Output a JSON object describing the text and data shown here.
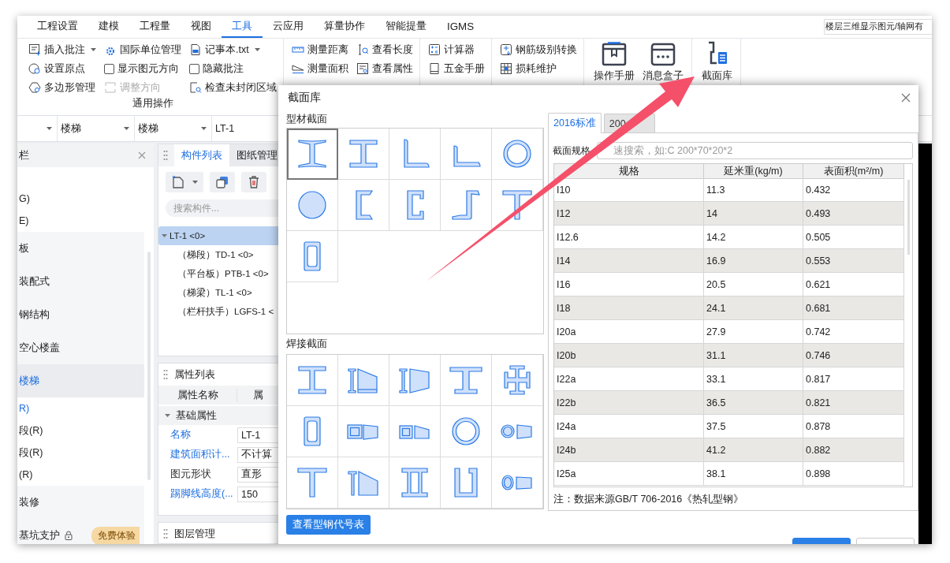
{
  "ribbon_tabs": [
    {
      "label": "工程设置",
      "selected": false
    },
    {
      "label": "建模",
      "selected": false
    },
    {
      "label": "工程量",
      "selected": false
    },
    {
      "label": "视图",
      "selected": false
    },
    {
      "label": "工具",
      "selected": true
    },
    {
      "label": "云应用",
      "selected": false
    },
    {
      "label": "算量协作",
      "selected": false
    },
    {
      "label": "智能提量",
      "selected": false
    },
    {
      "label": "IGMS",
      "selected": false
    }
  ],
  "floor_display_field": {
    "value": "楼层三维显示图元/轴网有"
  },
  "ribbon_groups": [
    {
      "title": "通用操作",
      "items": [
        {
          "kind": "button",
          "label": "插入批注",
          "dropdown": true,
          "disabled": false
        },
        {
          "kind": "button",
          "label": "国际单位管理",
          "dropdown": false,
          "disabled": false
        },
        {
          "kind": "button",
          "label": "记事本.txt",
          "dropdown": true,
          "disabled": false
        },
        {
          "kind": "button",
          "label": "设置原点",
          "dropdown": false,
          "disabled": false
        },
        {
          "kind": "checkbox",
          "label": "显示图元方向",
          "checked": false,
          "dropdown": false,
          "disabled": false
        },
        {
          "kind": "checkbox",
          "label": "隐藏批注",
          "checked": false,
          "dropdown": false,
          "disabled": false
        },
        {
          "kind": "button",
          "label": "多边形管理",
          "dropdown": false,
          "disabled": false
        },
        {
          "kind": "button",
          "label": "调整方向",
          "dropdown": false,
          "disabled": true
        },
        {
          "kind": "button",
          "label": "检查未封闭区域",
          "dropdown": false,
          "disabled": false
        }
      ]
    },
    {
      "items": [
        {
          "kind": "button",
          "label": "测量距离",
          "dropdown": false,
          "disabled": false
        },
        {
          "kind": "button",
          "label": "查看长度",
          "dropdown": false,
          "disabled": false
        },
        {
          "kind": "button",
          "label": "测量面积",
          "dropdown": false,
          "disabled": false
        },
        {
          "kind": "button",
          "label": "查看属性",
          "dropdown": false,
          "disabled": false
        }
      ]
    },
    {
      "items": [
        {
          "kind": "button",
          "label": "计算器",
          "dropdown": false,
          "disabled": false
        },
        {
          "kind": "button",
          "label": "五金手册",
          "dropdown": false,
          "disabled": false
        }
      ]
    },
    {
      "items": [
        {
          "kind": "button",
          "label": "钢筋级别转换",
          "dropdown": false,
          "disabled": false
        },
        {
          "kind": "button",
          "label": "损耗维护",
          "dropdown": false,
          "disabled": false
        }
      ]
    },
    {
      "items": [
        {
          "kind": "large",
          "label": "操作手册",
          "dropdown": false,
          "disabled": false
        },
        {
          "kind": "large",
          "label": "消息盒子",
          "dropdown": false,
          "disabled": false
        }
      ]
    },
    {
      "items": [
        {
          "kind": "large",
          "label": "截面库",
          "dropdown": false,
          "disabled": false
        }
      ]
    }
  ],
  "selectors": [
    {
      "value": "楼梯"
    },
    {
      "value": "楼梯"
    },
    {
      "value": "LT-1"
    }
  ],
  "nav_panel": {
    "title": "栏",
    "items": [
      {
        "kind": "item",
        "label": "G)",
        "selected": false,
        "locked": false
      },
      {
        "kind": "item",
        "label": "E)",
        "selected": false,
        "locked": false
      },
      {
        "kind": "category",
        "label": "板",
        "selected": false,
        "locked": false
      },
      {
        "kind": "category",
        "label": "装配式",
        "selected": false,
        "locked": false
      },
      {
        "kind": "category",
        "label": "钢结构",
        "selected": false,
        "locked": false
      },
      {
        "kind": "category",
        "label": "空心楼盖",
        "selected": false,
        "locked": false
      },
      {
        "kind": "category",
        "label": "楼梯",
        "selected": true,
        "locked": false
      },
      {
        "kind": "item",
        "label": "R)",
        "selected": true,
        "locked": false
      },
      {
        "kind": "item",
        "label": "段(R)",
        "selected": false,
        "locked": false
      },
      {
        "kind": "item",
        "label": "段(R)",
        "selected": false,
        "locked": false
      },
      {
        "kind": "item",
        "label": "(R)",
        "selected": false,
        "locked": false
      },
      {
        "kind": "category",
        "label": "装修",
        "selected": false,
        "locked": false
      },
      {
        "kind": "category",
        "label": "基坑支护",
        "selected": false,
        "locked": true,
        "badge": "免费体验"
      }
    ]
  },
  "component_panel": {
    "tabs": [
      {
        "label": "构件列表",
        "selected": true
      },
      {
        "label": "图纸管理",
        "selected": false
      }
    ],
    "search": {
      "placeholder": "搜索构件..."
    },
    "tree": [
      {
        "label": "LT-1 <0>",
        "selected": true,
        "expanded": true,
        "children": [
          {
            "label": "（梯段）TD-1 <0>",
            "selected": false
          },
          {
            "label": "（平台板）PTB-1 <0>",
            "selected": false
          },
          {
            "label": "（梯梁）TL-1 <0>",
            "selected": false
          },
          {
            "label": "（栏杆扶手）LGFS-1 <",
            "selected": false
          }
        ]
      }
    ]
  },
  "properties_panel": {
    "title": "属性列表",
    "columns": [
      "属性名称",
      "属"
    ],
    "group": {
      "label": "基础属性",
      "expanded": true
    },
    "rows": [
      {
        "name": "名称",
        "value": "LT-1",
        "color": "#1f6fe0"
      },
      {
        "name": "建筑面积计...",
        "value": "不计算",
        "color": "#1f6fe0"
      },
      {
        "name": "图元形状",
        "value": "直形",
        "color": "#333333"
      },
      {
        "name": "踢脚线高度(...",
        "value": "150",
        "color": "#1f6fe0"
      }
    ]
  },
  "layers_panel": {
    "title": "图层管理"
  },
  "dialog": {
    "title": "截面库",
    "profile_sections": {
      "title": "型材截面",
      "items": [
        {
          "kind": "i-tapered",
          "selected": true
        },
        {
          "kind": "i-beam",
          "selected": false
        },
        {
          "kind": "angle-equal",
          "selected": false
        },
        {
          "kind": "angle-unequal",
          "selected": false
        },
        {
          "kind": "pipe",
          "selected": false
        },
        {
          "kind": "round-bar",
          "selected": false
        },
        {
          "kind": "channel-tapered",
          "selected": false
        },
        {
          "kind": "channel",
          "selected": false
        },
        {
          "kind": "z-section",
          "selected": false
        },
        {
          "kind": "t-section",
          "selected": false
        },
        {
          "kind": "rect-tube",
          "selected": false
        }
      ]
    },
    "welded_sections": {
      "title": "焊接截面",
      "items": [
        {
          "kind": "i-beam",
          "selected": false
        },
        {
          "kind": "i-variable",
          "selected": false
        },
        {
          "kind": "i-variable-wide",
          "selected": false
        },
        {
          "kind": "i-wide",
          "selected": false
        },
        {
          "kind": "cross",
          "selected": false
        },
        {
          "kind": "rect-tube",
          "selected": false
        },
        {
          "kind": "box-variable",
          "selected": false
        },
        {
          "kind": "box-variable-small",
          "selected": false
        },
        {
          "kind": "pipe",
          "selected": false
        },
        {
          "kind": "pipe-variable",
          "selected": false
        },
        {
          "kind": "t-section",
          "selected": false
        },
        {
          "kind": "t-variable",
          "selected": false
        },
        {
          "kind": "double-i",
          "selected": false
        },
        {
          "kind": "u-section",
          "selected": false
        },
        {
          "kind": "ellipse-variable",
          "selected": false
        }
      ]
    },
    "code_table_button": "查看型钢代号表",
    "standard_tabs": [
      {
        "label": "2016标准",
        "selected": true
      },
      {
        "label": "200",
        "selected": false
      }
    ],
    "search": {
      "label": "截面规格",
      "placeholder": "速搜索，如:C 200*70*20*2"
    },
    "table": {
      "columns": [
        "规格",
        "延米重(kg/m)",
        "表面积(m²/m)"
      ],
      "rows": [
        [
          "I10",
          "11.3",
          "0.432"
        ],
        [
          "I12",
          "14",
          "0.493"
        ],
        [
          "I12.6",
          "14.2",
          "0.505"
        ],
        [
          "I14",
          "16.9",
          "0.553"
        ],
        [
          "I16",
          "20.5",
          "0.621"
        ],
        [
          "I18",
          "24.1",
          "0.681"
        ],
        [
          "I20a",
          "27.9",
          "0.742"
        ],
        [
          "I20b",
          "31.1",
          "0.746"
        ],
        [
          "I22a",
          "33.1",
          "0.817"
        ],
        [
          "I22b",
          "36.5",
          "0.821"
        ],
        [
          "I24a",
          "37.5",
          "0.878"
        ],
        [
          "I24b",
          "41.2",
          "0.882"
        ],
        [
          "I25a",
          "38.1",
          "0.898"
        ]
      ]
    },
    "note": "注：数据来源GB/T 706-2016《热轧型钢》"
  }
}
